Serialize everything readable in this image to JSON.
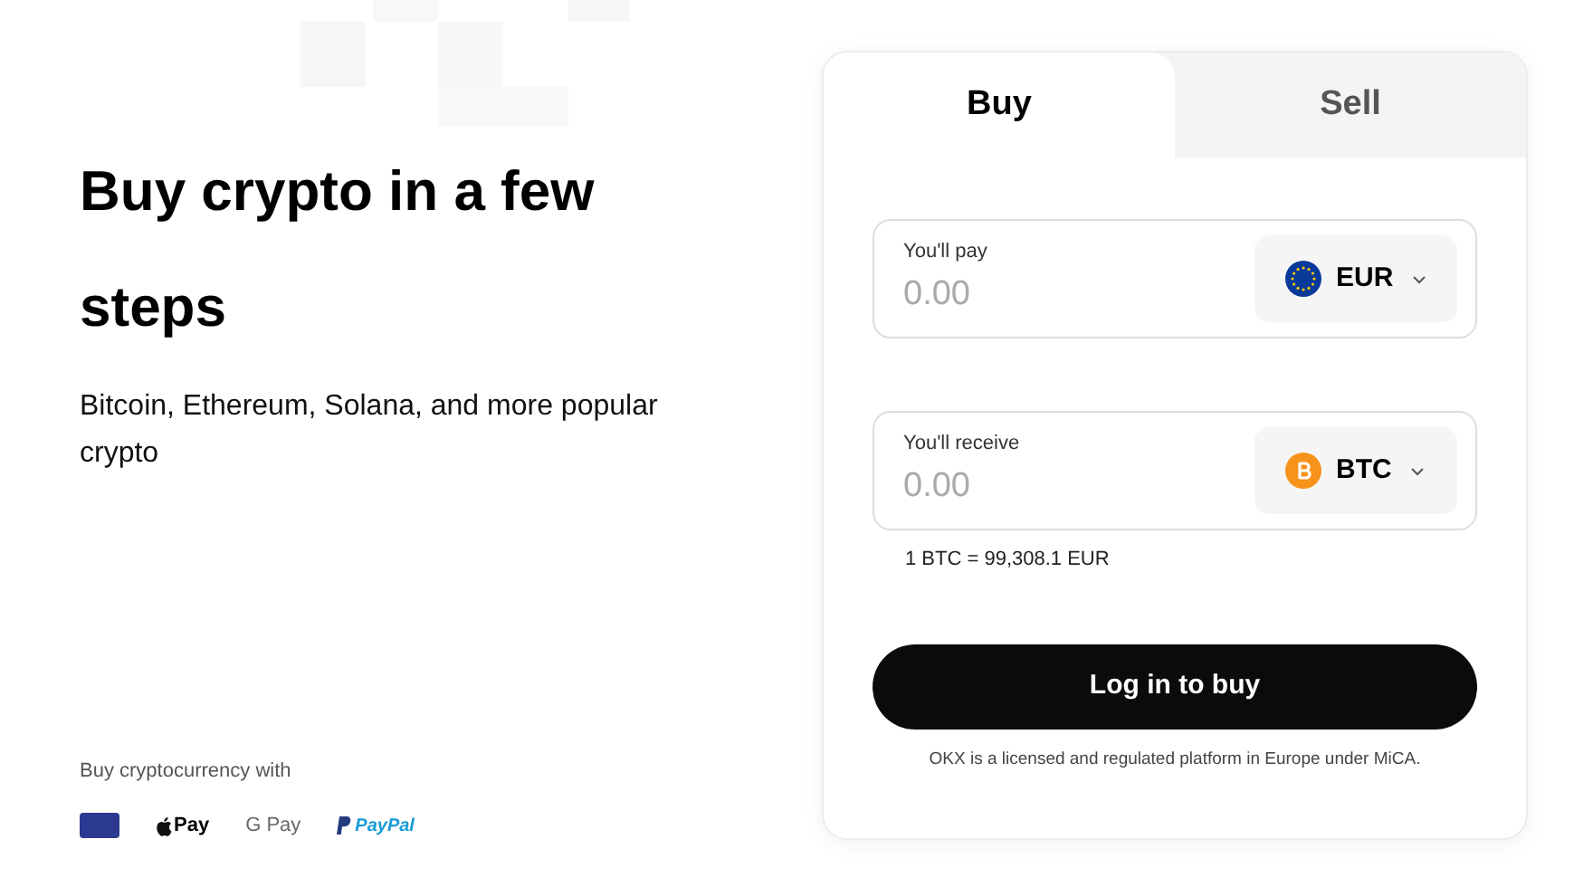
{
  "hero": {
    "title": "Buy crypto in a few steps",
    "subtitle": "Bitcoin, Ethereum, Solana, and more popular crypto"
  },
  "payments": {
    "label": "Buy cryptocurrency with",
    "methods": [
      {
        "kind": "card"
      },
      {
        "kind": "apple",
        "label": "Pay"
      },
      {
        "kind": "google",
        "label": "G Pay"
      },
      {
        "kind": "paypal",
        "label": "PayPal"
      }
    ]
  },
  "tabs": [
    {
      "label": "Buy",
      "selected": true
    },
    {
      "label": "Sell",
      "selected": false
    }
  ],
  "fields": [
    {
      "label": "You'll pay",
      "placeholder": "0.00",
      "currency": "EUR",
      "kind": "eur"
    },
    {
      "label": "You'll receive",
      "placeholder": "0.00",
      "currency": "BTC",
      "kind": "btc"
    }
  ],
  "rate": "1 BTC = 99,308.1 EUR",
  "action_button": "Log in to buy",
  "disclaimer": "OKX is a licensed and regulated platform in Europe under MiCA."
}
